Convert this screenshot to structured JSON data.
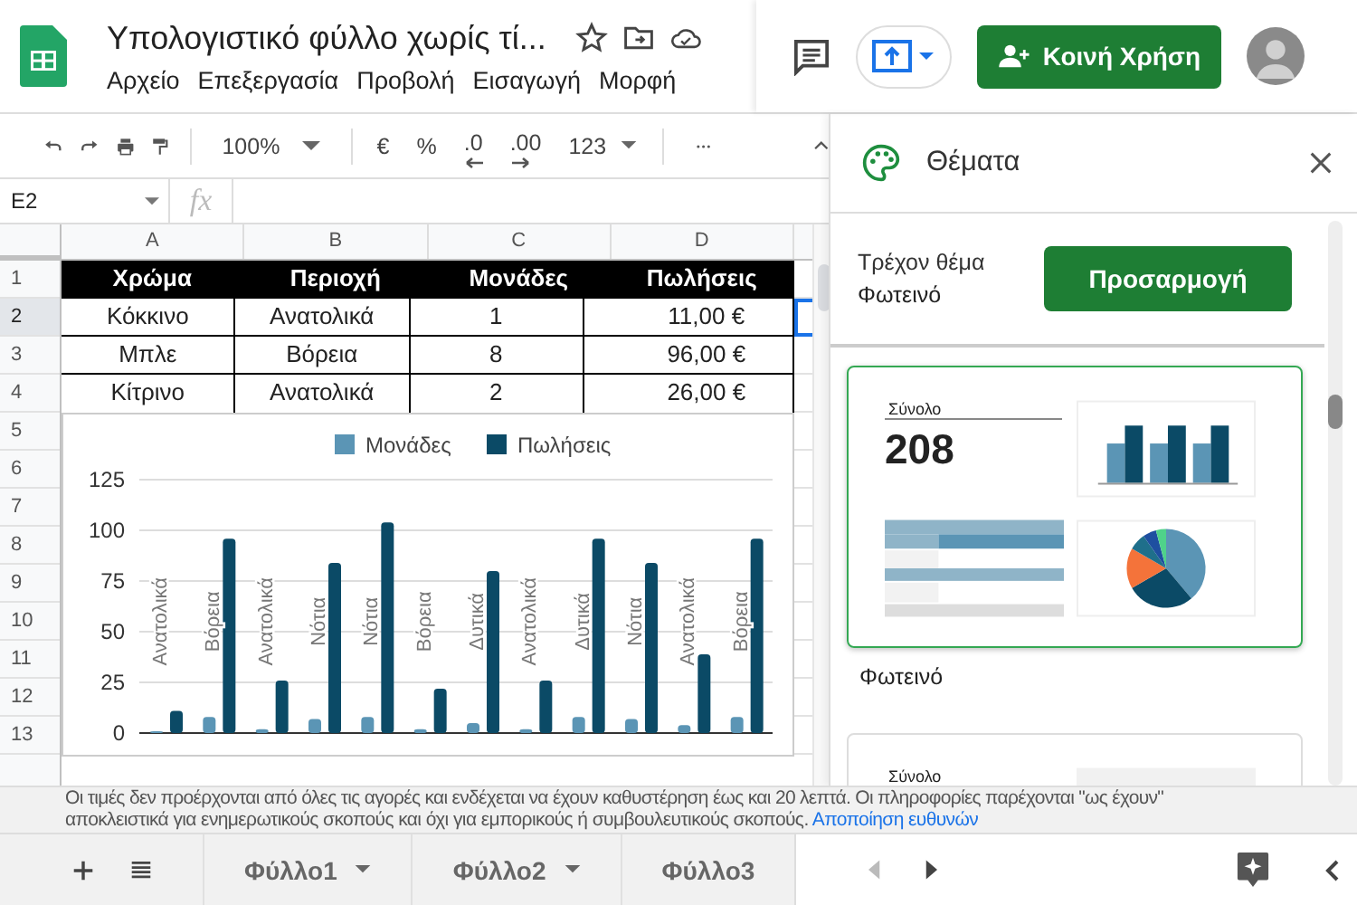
{
  "doc": {
    "title": "Υπολογιστικό φύλλο χωρίς τί...",
    "menu": [
      "Αρχείο",
      "Επεξεργασία",
      "Προβολή",
      "Εισαγωγή",
      "Μορφή"
    ]
  },
  "header": {
    "share_button": "Κοινή Χρήση"
  },
  "toolbar": {
    "zoom": "100%",
    "currency": "€",
    "percent": "%",
    "decimals_less": ".0",
    "decimals_more": ".00",
    "format": "123"
  },
  "formula_bar": {
    "cell_ref": "E2",
    "fx": "fx"
  },
  "sheet": {
    "columns": [
      "A",
      "B",
      "C",
      "D"
    ],
    "rows": [
      {
        "label": "1",
        "selected": false
      },
      {
        "label": "2",
        "selected": true
      },
      {
        "label": "3",
        "selected": false
      },
      {
        "label": "4",
        "selected": false
      },
      {
        "label": "5",
        "selected": false
      },
      {
        "label": "6",
        "selected": false
      },
      {
        "label": "7",
        "selected": false
      },
      {
        "label": "8",
        "selected": false
      },
      {
        "label": "9",
        "selected": false
      },
      {
        "label": "10",
        "selected": false
      },
      {
        "label": "11",
        "selected": false
      },
      {
        "label": "12",
        "selected": false
      },
      {
        "label": "13",
        "selected": false
      }
    ],
    "header": [
      "Χρώμα",
      "Περιοχή",
      "Μονάδες",
      "Πωλήσεις"
    ],
    "data": [
      [
        "Κόκκινο",
        "Ανατολικά",
        "1",
        "11,00 €"
      ],
      [
        "Μπλε",
        "Βόρεια",
        "8",
        "96,00 €"
      ],
      [
        "Κίτρινο",
        "Ανατολικά",
        "2",
        "26,00 €"
      ]
    ],
    "chart_data": {
      "type": "bar",
      "grid": true,
      "legend": "top",
      "ylim": [
        0,
        125
      ],
      "yticks": [
        0,
        25,
        50,
        75,
        100,
        125
      ],
      "series": [
        {
          "name": "Μονάδες",
          "color": "#5b95b5",
          "values": [
            0,
            7,
            1,
            6,
            7,
            1,
            4,
            1,
            7,
            6,
            3,
            7
          ]
        },
        {
          "name": "Πωλήσεις",
          "color": "#0b4a66",
          "values": [
            10,
            95,
            25,
            83,
            103,
            21,
            79,
            25,
            95,
            83,
            38,
            95
          ]
        }
      ],
      "annotations": [
        "Ανατολικά",
        "Βόρεια",
        "Ανατολικά",
        "Νότια",
        "Νότια",
        "Βόρεια",
        "Δυτικά",
        "Ανατολικά",
        "Δυτικά",
        "Νότια",
        "Ανατολικά",
        "Βόρεια"
      ]
    }
  },
  "panel": {
    "title": "Θέματα",
    "current_label": "Τρέχον θέμα",
    "current_value": "Φωτεινό",
    "customize_button": "Προσαρμογή",
    "themes": [
      {
        "name": "Φωτεινό",
        "selected": true,
        "total_label": "Σύνολο",
        "total_value": "208"
      },
      {
        "selected": false,
        "total_label": "Σύνολο"
      }
    ]
  },
  "notice": {
    "line1": "Οι τιμές δεν προέρχονται από όλες τις αγορές και ενδέχεται να έχουν καθυστέρηση έως και 20 λεπτά. Οι πληροφορίες παρέχονται \"ως έχουν\"",
    "line2": "αποκλειστικά για ενημερωτικούς σκοπούς και όχι για εμπορικούς ή συμβουλευτικούς σκοπούς.",
    "link": "Αποποίηση ευθυνών"
  },
  "sheet_tabs": [
    {
      "label": "Φύλλο1",
      "menu": true
    },
    {
      "label": "Φύλλο2",
      "menu": true
    },
    {
      "label": "Φύλλο3",
      "menu": false
    }
  ]
}
